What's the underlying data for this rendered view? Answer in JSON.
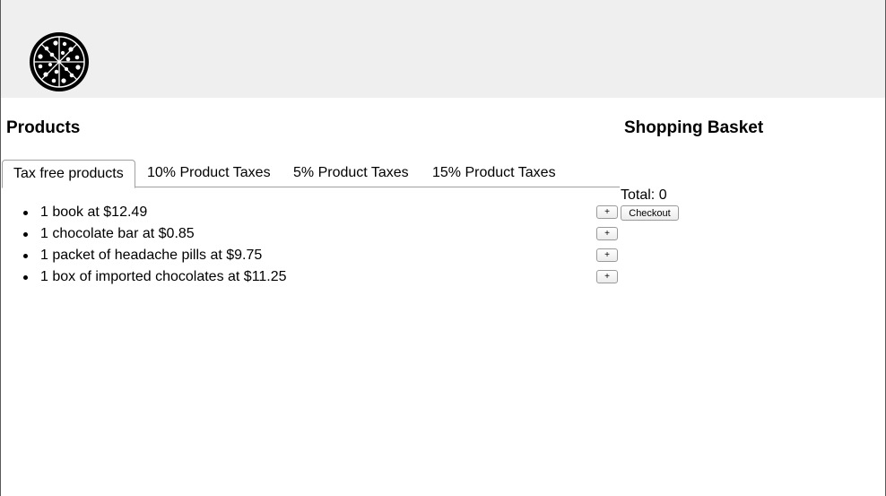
{
  "header": {
    "logo_icon": "pizza-icon"
  },
  "products": {
    "title": "Products",
    "tabs": [
      {
        "label": "Tax free products",
        "active": true
      },
      {
        "label": "10% Product Taxes",
        "active": false
      },
      {
        "label": "5% Product Taxes",
        "active": false
      },
      {
        "label": "15% Product Taxes",
        "active": false
      }
    ],
    "items": [
      {
        "text": "1 book at $12.49",
        "add_label": "+"
      },
      {
        "text": "1 chocolate bar at $0.85",
        "add_label": "+"
      },
      {
        "text": "1 packet of headache pills at $9.75",
        "add_label": "+"
      },
      {
        "text": "1 box of imported chocolates at $11.25",
        "add_label": "+"
      }
    ]
  },
  "basket": {
    "title": "Shopping Basket",
    "total_text": "Total: 0",
    "checkout_label": "Checkout"
  }
}
